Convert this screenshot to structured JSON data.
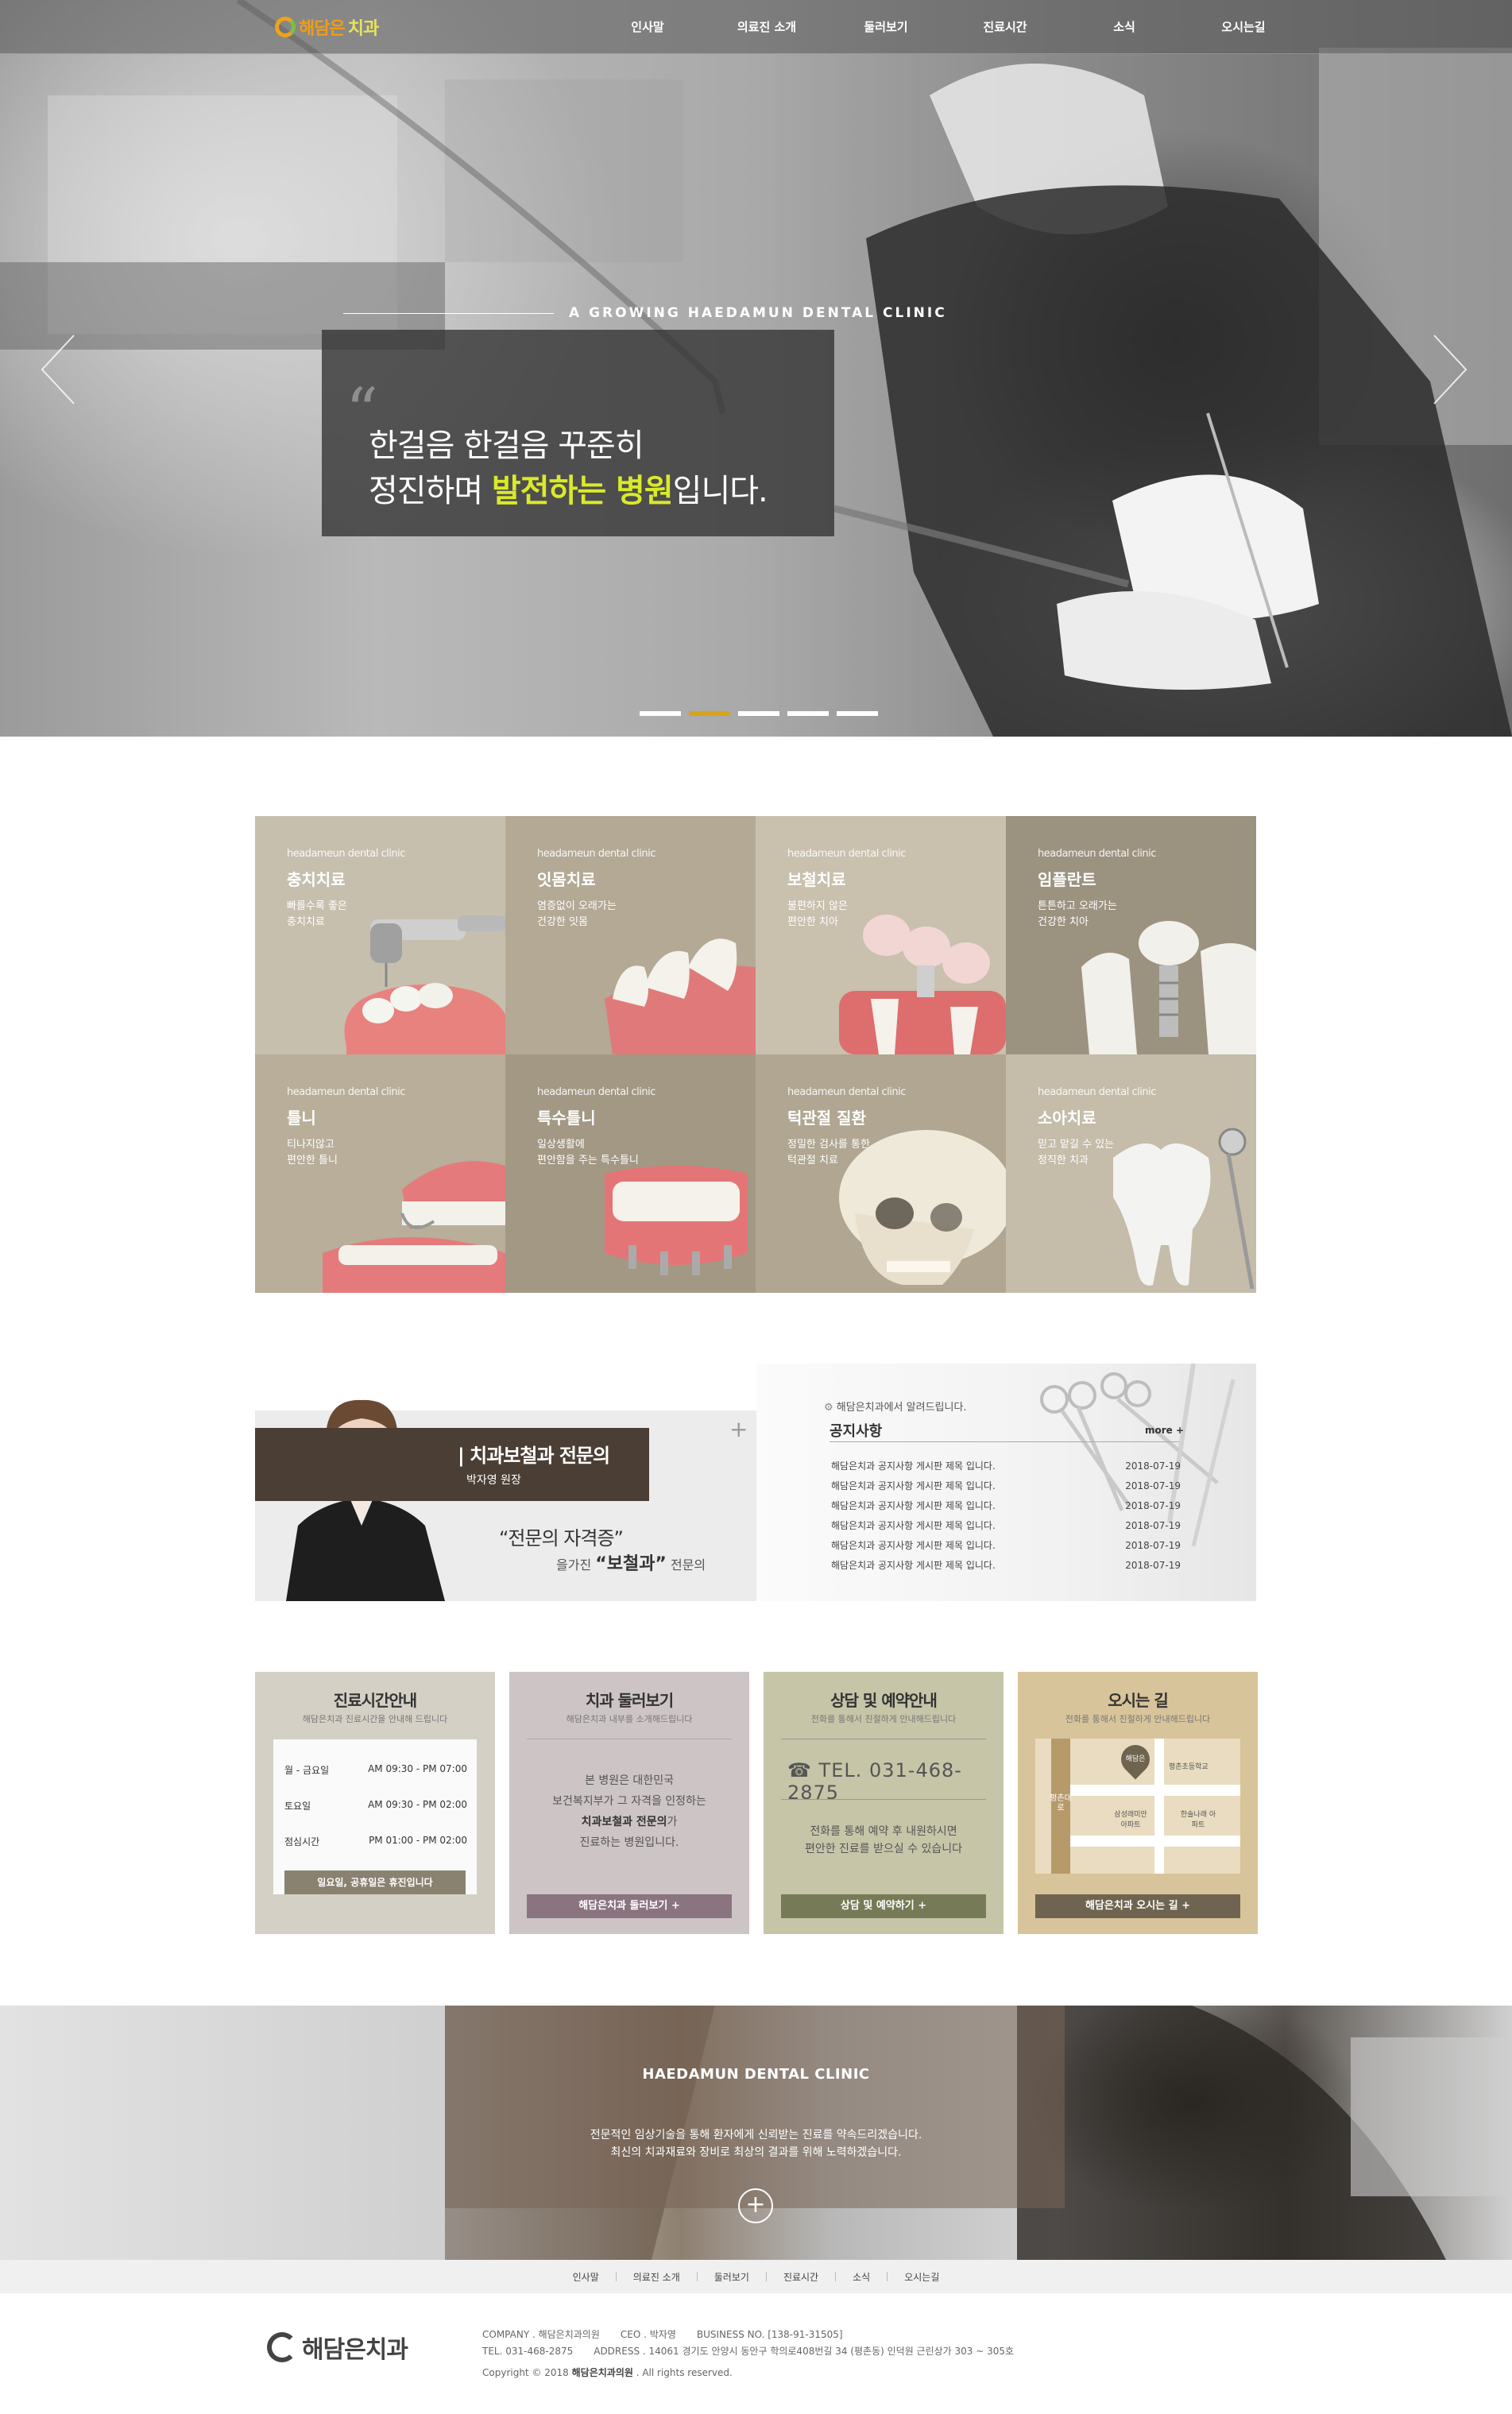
{
  "header": {
    "logo_text_1": "해담은",
    "logo_text_2": "치과",
    "nav": [
      "인사말",
      "의료진 소개",
      "둘러보기",
      "진료시간",
      "소식",
      "오시는길"
    ]
  },
  "hero": {
    "slogan_en": "A GROWING HAEDAMUN DENTAL CLINIC",
    "line1": "한걸음 한걸음 꾸준히",
    "line2_pre": "정진하며 ",
    "line2_hl": "발전하는 병원",
    "line2_post": "입니다.",
    "slides": 5,
    "active_slide": 2
  },
  "treatments": [
    {
      "en": "headameun dental clinic",
      "ko": "충치치료",
      "desc1": "빠를수록 좋은",
      "desc2": "충치치료",
      "bg": "#c7bfae",
      "icon": "drill-tooth-icon"
    },
    {
      "en": "headameun dental clinic",
      "ko": "잇몸치료",
      "desc1": "염증없이 오래가는",
      "desc2": "건강한 잇몸",
      "bg": "#b3a995",
      "icon": "gum-icon"
    },
    {
      "en": "headameun dental clinic",
      "ko": "보철치료",
      "desc1": "불편하지 않은",
      "desc2": "편안한 치아",
      "bg": "#c9c0ae",
      "icon": "crown-bridge-icon"
    },
    {
      "en": "headameun dental clinic",
      "ko": "임플란트",
      "desc1": "튼튼하고 오래가는",
      "desc2": "건강한 치아",
      "bg": "#9c9280",
      "icon": "implant-icon"
    },
    {
      "en": "headameun dental clinic",
      "ko": "틀니",
      "desc1": "티나지않고",
      "desc2": "편안한 틀니",
      "bg": "#b8ae9a",
      "icon": "denture-icon"
    },
    {
      "en": "headameun dental clinic",
      "ko": "특수틀니",
      "desc1": "일상생활에",
      "desc2": "편안함을 주는 특수틀니",
      "bg": "#a39884",
      "icon": "special-denture-icon"
    },
    {
      "en": "headameun dental clinic",
      "ko": "턱관절 질환",
      "desc1": "정밀한 검사를 통한",
      "desc2": "턱관절 치료",
      "bg": "#b0a691",
      "icon": "skull-icon"
    },
    {
      "en": "headameun dental clinic",
      "ko": "소아치료",
      "desc1": "믿고 맡길 수 있는",
      "desc2": "정직한 치과",
      "bg": "#c5bca9",
      "icon": "tooth-mirror-icon"
    }
  ],
  "doctor": {
    "title": "| 치과보철과 전문의",
    "name": "박자영 원장",
    "quote1": "“전문의 자격증”",
    "quote2_pre": "을가진 ",
    "quote2_hl": "“보철과”",
    "quote2_post": " 전문의"
  },
  "notice": {
    "sub": "해담은치과에서 알려드립니다.",
    "title": "공지사항",
    "more": "more +",
    "items": [
      {
        "title": "해담은치과 공지사항 게시판 제목 입니다.",
        "date": "2018-07-19"
      },
      {
        "title": "해담은치과 공지사항 게시판 제목 입니다.",
        "date": "2018-07-19"
      },
      {
        "title": "해담은치과 공지사항 게시판 제목 입니다.",
        "date": "2018-07-19"
      },
      {
        "title": "해담은치과 공지사항 게시판 제목 입니다.",
        "date": "2018-07-19"
      },
      {
        "title": "해담은치과 공지사항 게시판 제목 입니다.",
        "date": "2018-07-19"
      },
      {
        "title": "해담은치과 공지사항 게시판 제목 입니다.",
        "date": "2018-07-19"
      }
    ]
  },
  "cards": {
    "hours": {
      "title": "진료시간안내",
      "sub": "해담은치과 진료시간을 안내해 드립니다",
      "rows": [
        {
          "day": "월 - 금요일",
          "time": "AM 09:30 - PM 07:00"
        },
        {
          "day": "토요일",
          "time": "AM 09:30 - PM 02:00"
        },
        {
          "day": "점심시간",
          "time": "PM 01:00 - PM 02:00"
        }
      ],
      "note": "일요일, 공휴일은 휴진입니다",
      "bg": "#d5d0c5"
    },
    "tour": {
      "title": "치과 둘러보기",
      "sub": "해담은치과 내부를 소개해드립니다",
      "t1": "본 병원은 대한민국",
      "t2": "보건복지부가 그 자격을 인정하는",
      "t3_hl": "치과보철과 전문의",
      "t3_post": "가",
      "t4": "진료하는 병원입니다.",
      "button": "해담은치과 둘러보기 +",
      "bg": "#cdc4c6"
    },
    "consult": {
      "title": "상담 및 예약안내",
      "sub": "전화를 통해서 친절하게 안내해드립니다",
      "tel": "TEL. 031-468-2875",
      "t1": "전화를 통해 예약 후 내원하시면",
      "t2": "편안한 진료를 받으실 수 있습니다",
      "button": "상담 및 예약하기 +",
      "bg": "#c6c5a8"
    },
    "map": {
      "title": "오시는 길",
      "sub": "전화를 통해서 친절하게 안내해드립니다",
      "pin": "해담은",
      "road": "평촌대로",
      "school": "평촌초등학교",
      "apt1": "삼성래미안 아파트",
      "apt2": "한솔나래 아파트",
      "button": "해담은치과 오시는 길 +",
      "bg": "#d8c49a"
    }
  },
  "banner": {
    "title": "HAEDAMUN DENTAL CLINIC",
    "t1": "전문적인 임상기술을 통해 환자에게 신뢰받는 진료를 약속드리겠습니다.",
    "t2": "최신의 치과재료와 장비로 최상의 결과를 위해 노력하겠습니다."
  },
  "footer": {
    "nav": [
      "인사말",
      "의료진 소개",
      "둘러보기",
      "진료시간",
      "소식",
      "오시는길"
    ],
    "logo": "해담은치과",
    "company": "COMPANY . 해담은치과의원",
    "ceo": "CEO . 박자영",
    "business": "BUSINESS NO. [138-91-31505]",
    "tel": "TEL. 031-468-2875",
    "address": "ADDRESS . 14061 경기도 안양시 동안구 학의로408번길 34 (평촌동) 인덕원 근린상가 303 ~ 305호",
    "copy_pre": "Copyright © 2018 ",
    "copy_hl": "해담은치과의원",
    "copy_post": " . All rights reserved."
  }
}
